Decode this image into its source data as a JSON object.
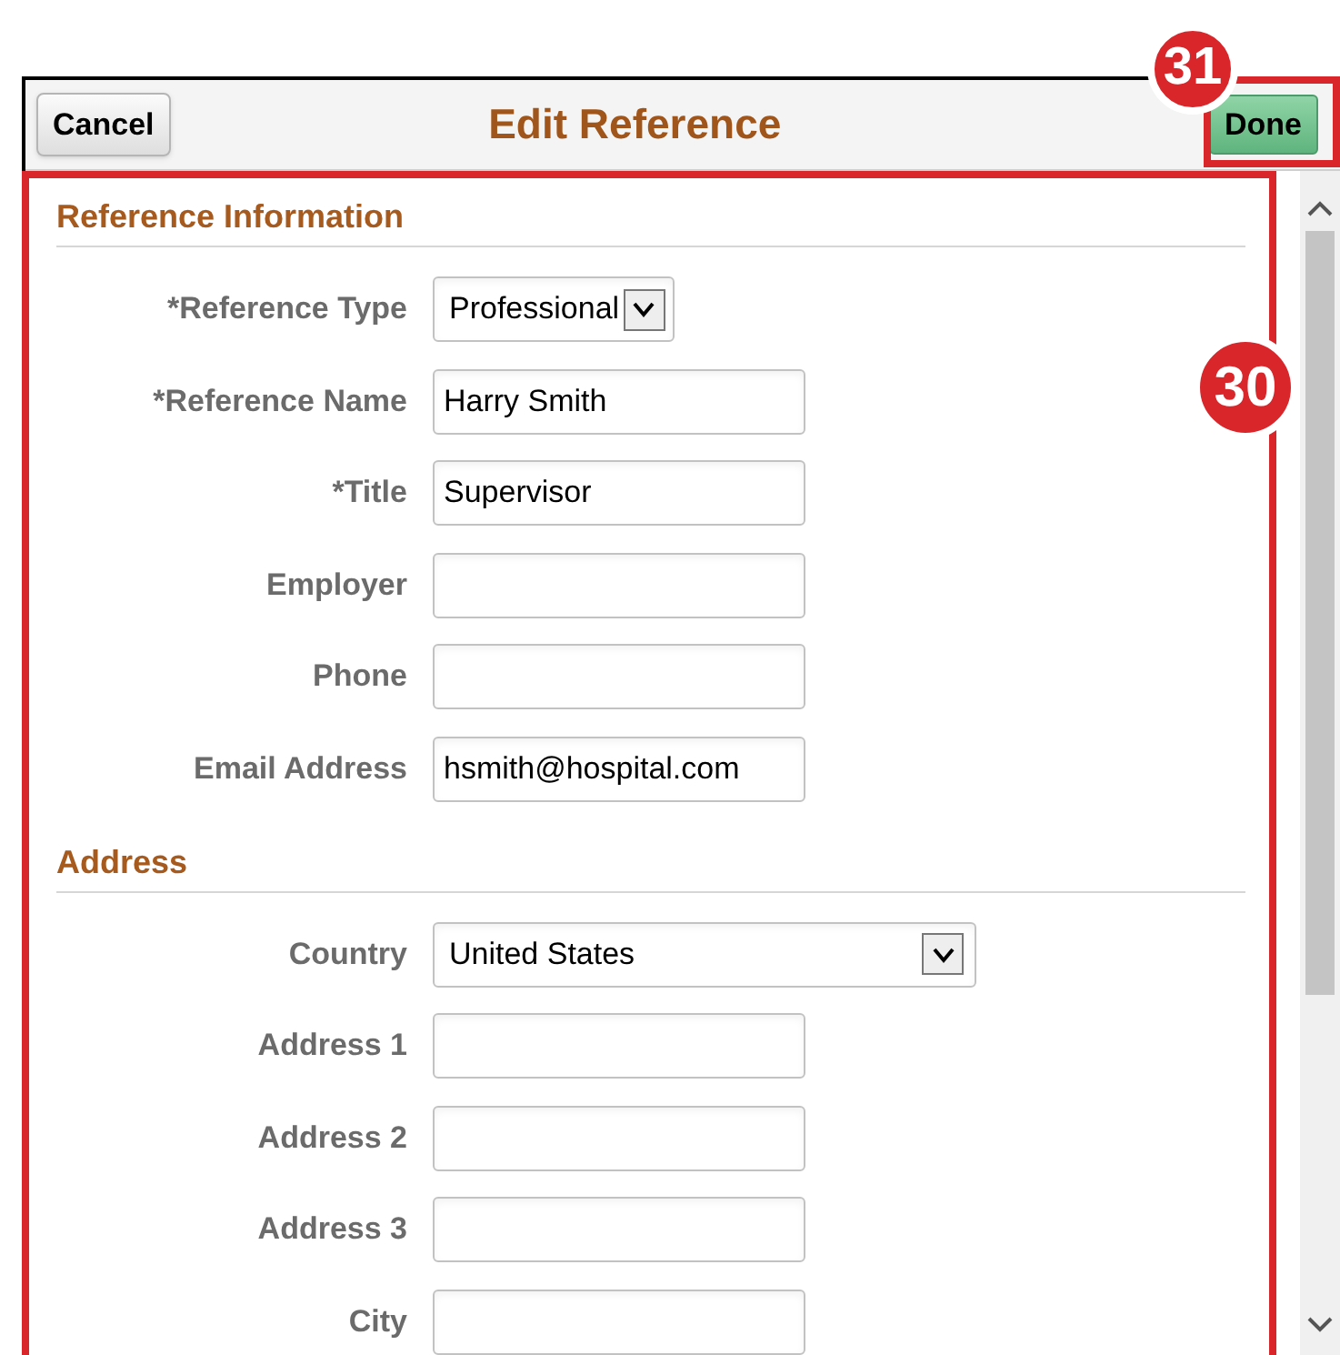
{
  "header": {
    "cancel": "Cancel",
    "title": "Edit Reference",
    "done": "Done"
  },
  "callouts": [
    {
      "label": "31"
    },
    {
      "label": "30"
    }
  ],
  "sections": [
    {
      "title": "Reference Information",
      "fields": [
        {
          "label": "*Reference Type",
          "kind": "select",
          "value": "Professional"
        },
        {
          "label": "*Reference Name",
          "kind": "text",
          "value": "Harry Smith"
        },
        {
          "label": "*Title",
          "kind": "text",
          "value": "Supervisor"
        },
        {
          "label": "Employer",
          "kind": "text"
        },
        {
          "label": "Phone",
          "kind": "text"
        },
        {
          "label": "Email Address",
          "kind": "text",
          "value": "hsmith@hospital.com"
        }
      ]
    },
    {
      "title": "Address",
      "fields": [
        {
          "label": "Country",
          "kind": "wideselect",
          "value": "United States"
        },
        {
          "label": "Address 1",
          "kind": "text"
        },
        {
          "label": "Address 2",
          "kind": "text"
        },
        {
          "label": "Address 3",
          "kind": "text"
        },
        {
          "label": "City",
          "kind": "text"
        }
      ]
    }
  ]
}
